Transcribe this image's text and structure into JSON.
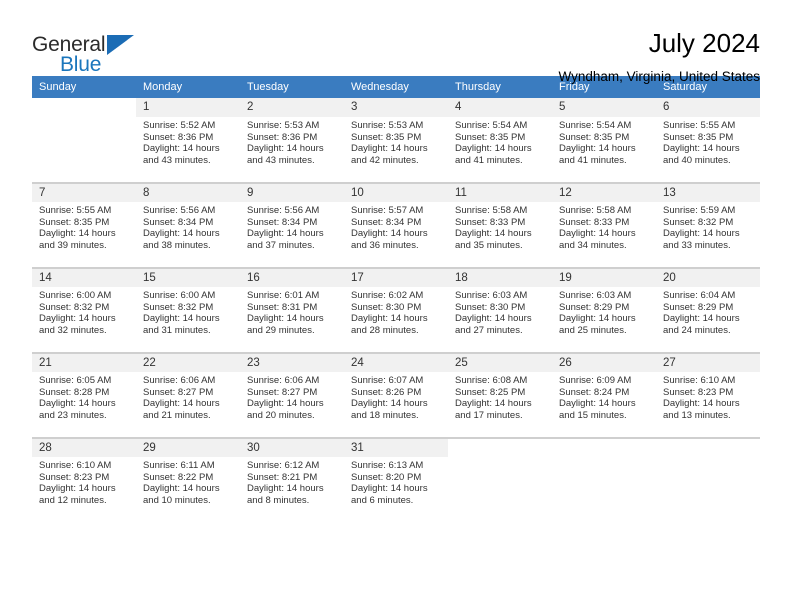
{
  "brand": {
    "name_primary": "General",
    "name_secondary": "Blue",
    "triangle_color": "#1b6cb5"
  },
  "header": {
    "title": "July 2024",
    "location": "Wyndham, Virginia, United States"
  },
  "theme": {
    "header_row_bg": "#3a7cc0",
    "daynum_bg": "#f1f1f1",
    "grid_line": "#cfcfcf",
    "text": "#333333"
  },
  "weekday_headers": [
    "Sunday",
    "Monday",
    "Tuesday",
    "Wednesday",
    "Thursday",
    "Friday",
    "Saturday"
  ],
  "labels": {
    "sunrise_prefix": "Sunrise:",
    "sunset_prefix": "Sunset:",
    "daylight_prefix": "Daylight:"
  },
  "weeks": [
    [
      {
        "day": "",
        "sunrise": "",
        "sunset": "",
        "daylight_line1": "",
        "daylight_line2": "",
        "empty": true
      },
      {
        "day": "1",
        "sunrise": "Sunrise: 5:52 AM",
        "sunset": "Sunset: 8:36 PM",
        "daylight_line1": "Daylight: 14 hours",
        "daylight_line2": "and 43 minutes."
      },
      {
        "day": "2",
        "sunrise": "Sunrise: 5:53 AM",
        "sunset": "Sunset: 8:36 PM",
        "daylight_line1": "Daylight: 14 hours",
        "daylight_line2": "and 43 minutes."
      },
      {
        "day": "3",
        "sunrise": "Sunrise: 5:53 AM",
        "sunset": "Sunset: 8:35 PM",
        "daylight_line1": "Daylight: 14 hours",
        "daylight_line2": "and 42 minutes."
      },
      {
        "day": "4",
        "sunrise": "Sunrise: 5:54 AM",
        "sunset": "Sunset: 8:35 PM",
        "daylight_line1": "Daylight: 14 hours",
        "daylight_line2": "and 41 minutes."
      },
      {
        "day": "5",
        "sunrise": "Sunrise: 5:54 AM",
        "sunset": "Sunset: 8:35 PM",
        "daylight_line1": "Daylight: 14 hours",
        "daylight_line2": "and 41 minutes."
      },
      {
        "day": "6",
        "sunrise": "Sunrise: 5:55 AM",
        "sunset": "Sunset: 8:35 PM",
        "daylight_line1": "Daylight: 14 hours",
        "daylight_line2": "and 40 minutes."
      }
    ],
    [
      {
        "day": "7",
        "sunrise": "Sunrise: 5:55 AM",
        "sunset": "Sunset: 8:35 PM",
        "daylight_line1": "Daylight: 14 hours",
        "daylight_line2": "and 39 minutes."
      },
      {
        "day": "8",
        "sunrise": "Sunrise: 5:56 AM",
        "sunset": "Sunset: 8:34 PM",
        "daylight_line1": "Daylight: 14 hours",
        "daylight_line2": "and 38 minutes."
      },
      {
        "day": "9",
        "sunrise": "Sunrise: 5:56 AM",
        "sunset": "Sunset: 8:34 PM",
        "daylight_line1": "Daylight: 14 hours",
        "daylight_line2": "and 37 minutes."
      },
      {
        "day": "10",
        "sunrise": "Sunrise: 5:57 AM",
        "sunset": "Sunset: 8:34 PM",
        "daylight_line1": "Daylight: 14 hours",
        "daylight_line2": "and 36 minutes."
      },
      {
        "day": "11",
        "sunrise": "Sunrise: 5:58 AM",
        "sunset": "Sunset: 8:33 PM",
        "daylight_line1": "Daylight: 14 hours",
        "daylight_line2": "and 35 minutes."
      },
      {
        "day": "12",
        "sunrise": "Sunrise: 5:58 AM",
        "sunset": "Sunset: 8:33 PM",
        "daylight_line1": "Daylight: 14 hours",
        "daylight_line2": "and 34 minutes."
      },
      {
        "day": "13",
        "sunrise": "Sunrise: 5:59 AM",
        "sunset": "Sunset: 8:32 PM",
        "daylight_line1": "Daylight: 14 hours",
        "daylight_line2": "and 33 minutes."
      }
    ],
    [
      {
        "day": "14",
        "sunrise": "Sunrise: 6:00 AM",
        "sunset": "Sunset: 8:32 PM",
        "daylight_line1": "Daylight: 14 hours",
        "daylight_line2": "and 32 minutes."
      },
      {
        "day": "15",
        "sunrise": "Sunrise: 6:00 AM",
        "sunset": "Sunset: 8:32 PM",
        "daylight_line1": "Daylight: 14 hours",
        "daylight_line2": "and 31 minutes."
      },
      {
        "day": "16",
        "sunrise": "Sunrise: 6:01 AM",
        "sunset": "Sunset: 8:31 PM",
        "daylight_line1": "Daylight: 14 hours",
        "daylight_line2": "and 29 minutes."
      },
      {
        "day": "17",
        "sunrise": "Sunrise: 6:02 AM",
        "sunset": "Sunset: 8:30 PM",
        "daylight_line1": "Daylight: 14 hours",
        "daylight_line2": "and 28 minutes."
      },
      {
        "day": "18",
        "sunrise": "Sunrise: 6:03 AM",
        "sunset": "Sunset: 8:30 PM",
        "daylight_line1": "Daylight: 14 hours",
        "daylight_line2": "and 27 minutes."
      },
      {
        "day": "19",
        "sunrise": "Sunrise: 6:03 AM",
        "sunset": "Sunset: 8:29 PM",
        "daylight_line1": "Daylight: 14 hours",
        "daylight_line2": "and 25 minutes."
      },
      {
        "day": "20",
        "sunrise": "Sunrise: 6:04 AM",
        "sunset": "Sunset: 8:29 PM",
        "daylight_line1": "Daylight: 14 hours",
        "daylight_line2": "and 24 minutes."
      }
    ],
    [
      {
        "day": "21",
        "sunrise": "Sunrise: 6:05 AM",
        "sunset": "Sunset: 8:28 PM",
        "daylight_line1": "Daylight: 14 hours",
        "daylight_line2": "and 23 minutes."
      },
      {
        "day": "22",
        "sunrise": "Sunrise: 6:06 AM",
        "sunset": "Sunset: 8:27 PM",
        "daylight_line1": "Daylight: 14 hours",
        "daylight_line2": "and 21 minutes."
      },
      {
        "day": "23",
        "sunrise": "Sunrise: 6:06 AM",
        "sunset": "Sunset: 8:27 PM",
        "daylight_line1": "Daylight: 14 hours",
        "daylight_line2": "and 20 minutes."
      },
      {
        "day": "24",
        "sunrise": "Sunrise: 6:07 AM",
        "sunset": "Sunset: 8:26 PM",
        "daylight_line1": "Daylight: 14 hours",
        "daylight_line2": "and 18 minutes."
      },
      {
        "day": "25",
        "sunrise": "Sunrise: 6:08 AM",
        "sunset": "Sunset: 8:25 PM",
        "daylight_line1": "Daylight: 14 hours",
        "daylight_line2": "and 17 minutes."
      },
      {
        "day": "26",
        "sunrise": "Sunrise: 6:09 AM",
        "sunset": "Sunset: 8:24 PM",
        "daylight_line1": "Daylight: 14 hours",
        "daylight_line2": "and 15 minutes."
      },
      {
        "day": "27",
        "sunrise": "Sunrise: 6:10 AM",
        "sunset": "Sunset: 8:23 PM",
        "daylight_line1": "Daylight: 14 hours",
        "daylight_line2": "and 13 minutes."
      }
    ],
    [
      {
        "day": "28",
        "sunrise": "Sunrise: 6:10 AM",
        "sunset": "Sunset: 8:23 PM",
        "daylight_line1": "Daylight: 14 hours",
        "daylight_line2": "and 12 minutes."
      },
      {
        "day": "29",
        "sunrise": "Sunrise: 6:11 AM",
        "sunset": "Sunset: 8:22 PM",
        "daylight_line1": "Daylight: 14 hours",
        "daylight_line2": "and 10 minutes."
      },
      {
        "day": "30",
        "sunrise": "Sunrise: 6:12 AM",
        "sunset": "Sunset: 8:21 PM",
        "daylight_line1": "Daylight: 14 hours",
        "daylight_line2": "and 8 minutes."
      },
      {
        "day": "31",
        "sunrise": "Sunrise: 6:13 AM",
        "sunset": "Sunset: 8:20 PM",
        "daylight_line1": "Daylight: 14 hours",
        "daylight_line2": "and 6 minutes."
      },
      {
        "day": "",
        "sunrise": "",
        "sunset": "",
        "daylight_line1": "",
        "daylight_line2": "",
        "empty": true
      },
      {
        "day": "",
        "sunrise": "",
        "sunset": "",
        "daylight_line1": "",
        "daylight_line2": "",
        "empty": true
      },
      {
        "day": "",
        "sunrise": "",
        "sunset": "",
        "daylight_line1": "",
        "daylight_line2": "",
        "empty": true
      }
    ]
  ]
}
